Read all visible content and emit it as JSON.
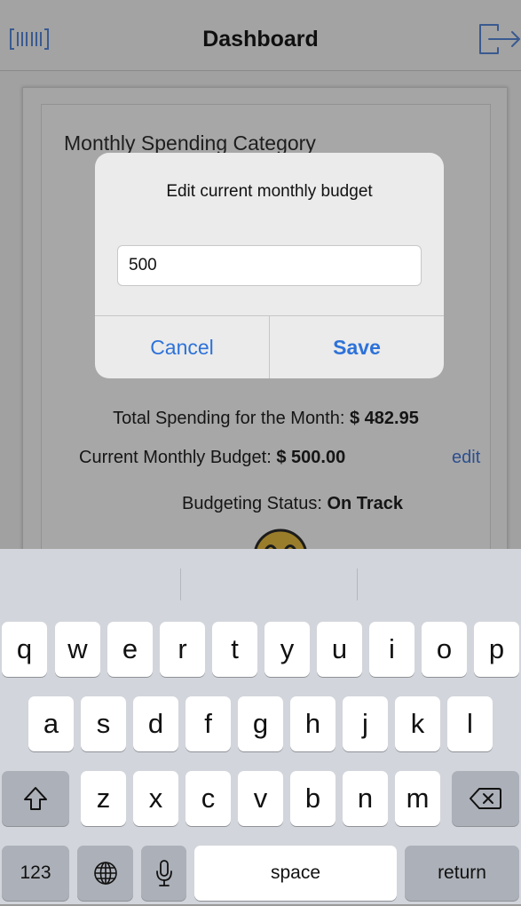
{
  "navbar": {
    "title": "Dashboard",
    "left_icon": "barcode-icon",
    "right_icon": "logout-icon"
  },
  "content": {
    "section_title": "Monthly Spending Category",
    "total_label": "Total Spending for the Month: ",
    "total_value": "$ 482.95",
    "budget_label": "Current Monthly Budget: ",
    "budget_value": "$ 500.00",
    "edit_label": "edit",
    "status_label": "Budgeting Status: ",
    "status_value": "On Track",
    "status_icon": "smiley-icon"
  },
  "alert": {
    "title": "Edit current monthly budget",
    "input_value": "500",
    "cancel_label": "Cancel",
    "save_label": "Save"
  },
  "keyboard": {
    "row1": [
      "q",
      "w",
      "e",
      "r",
      "t",
      "y",
      "u",
      "i",
      "o",
      "p"
    ],
    "row2": [
      "a",
      "s",
      "d",
      "f",
      "g",
      "h",
      "j",
      "k",
      "l"
    ],
    "row3": [
      "z",
      "x",
      "c",
      "v",
      "b",
      "n",
      "m"
    ],
    "shift_icon": "shift-icon",
    "delete_icon": "backspace-icon",
    "numbers_label": "123",
    "globe_icon": "globe-icon",
    "mic_icon": "microphone-icon",
    "space_label": "space",
    "return_label": "return"
  }
}
